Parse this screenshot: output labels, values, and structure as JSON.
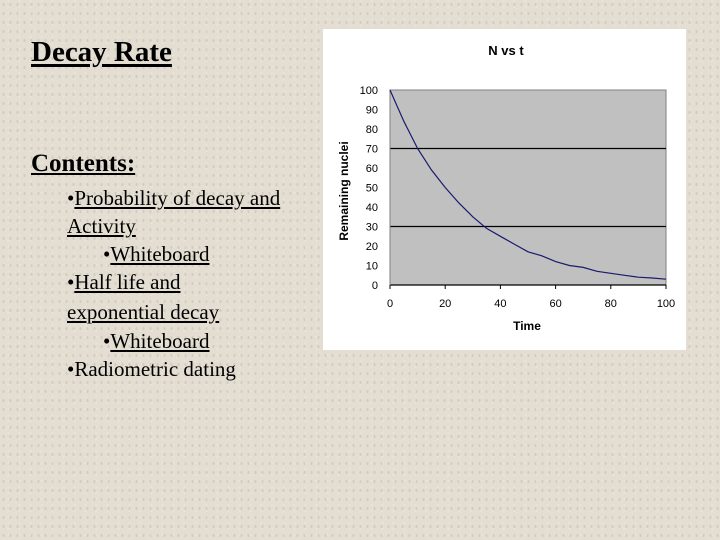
{
  "slide": {
    "title": "Decay Rate",
    "contents_heading": "Contents:",
    "bullet": "•",
    "items": [
      {
        "level": 1,
        "lines": [
          "Probability of decay and",
          "Activity"
        ],
        "link": true
      },
      {
        "level": 2,
        "lines": [
          "Whiteboard"
        ],
        "link": true
      },
      {
        "level": 1,
        "lines": [
          "Half life and",
          "exponential decay"
        ],
        "link": true
      },
      {
        "level": 2,
        "lines": [
          "Whiteboard"
        ],
        "link": true
      },
      {
        "level": 1,
        "lines": [
          "Radiometric dating"
        ],
        "link": false
      }
    ]
  },
  "colors": {
    "plot_background": "#c0c0c0",
    "series_line": "#1a1a6e",
    "gridline": "#000000",
    "chart_background": "#ffffff"
  },
  "chart_data": {
    "type": "line",
    "title": "N vs t",
    "xlabel": "Time",
    "ylabel": "Remaining nuclei",
    "xlim": [
      0,
      100
    ],
    "ylim": [
      0,
      100
    ],
    "xticks": [
      0,
      20,
      40,
      60,
      80,
      100
    ],
    "yticks": [
      0,
      10,
      20,
      30,
      40,
      50,
      60,
      70,
      80,
      90,
      100
    ],
    "gridlines_y": [
      30,
      70
    ],
    "legend": "none",
    "series": [
      {
        "name": "N",
        "x": [
          0,
          5,
          10,
          15,
          20,
          25,
          30,
          35,
          40,
          45,
          50,
          55,
          60,
          65,
          70,
          75,
          80,
          85,
          90,
          95,
          100
        ],
        "y": [
          100,
          84,
          70,
          59,
          50,
          42,
          35,
          29,
          25,
          21,
          17,
          15,
          12,
          10,
          9,
          7,
          6,
          5,
          4,
          3.6,
          3
        ]
      }
    ]
  }
}
